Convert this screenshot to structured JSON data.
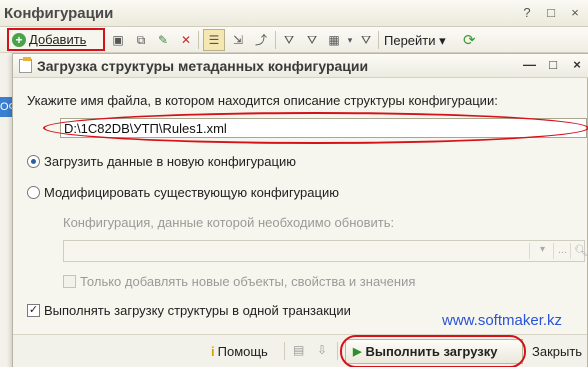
{
  "background_window": {
    "title": "Конфигурации",
    "window_buttons": [
      "?",
      "□",
      "×"
    ],
    "toolbar": {
      "add_label": "Добавить",
      "goto_label": "Перейти",
      "goto_arrow": "▾"
    },
    "left_item_text": "ОФ"
  },
  "dialog": {
    "title": "Загрузка структуры метаданных конфигурации",
    "window_buttons": [
      "—",
      "□",
      "×"
    ],
    "prompt": "Укажите имя файла, в котором находится описание структуры конфигурации:",
    "file_path": "D:\\1C82DB\\УТП\\Rules1.xml",
    "file_browse": "...",
    "option_new": "Загрузить данные в новую конфигурацию",
    "option_modify": "Модифицировать существующую конфигурацию",
    "selected_option": "new",
    "config_label": "Конфигурация, данные которой необходимо обновить:",
    "config_value": "",
    "only_add_label": "Только добавлять новые объекты, свойства и значения",
    "single_transaction_label": "Выполнять загрузку структуры в одной транзакции",
    "single_transaction_checked": true,
    "site_link": "www.softmaker.kz",
    "footer": {
      "help_label": "Помощь",
      "run_label": "Выполнить загрузку",
      "close_label": "Закрыть"
    }
  },
  "colors": {
    "highlight_red": "#d4121a",
    "link_blue": "#2a54d6",
    "run_green": "#2f8f2f"
  }
}
